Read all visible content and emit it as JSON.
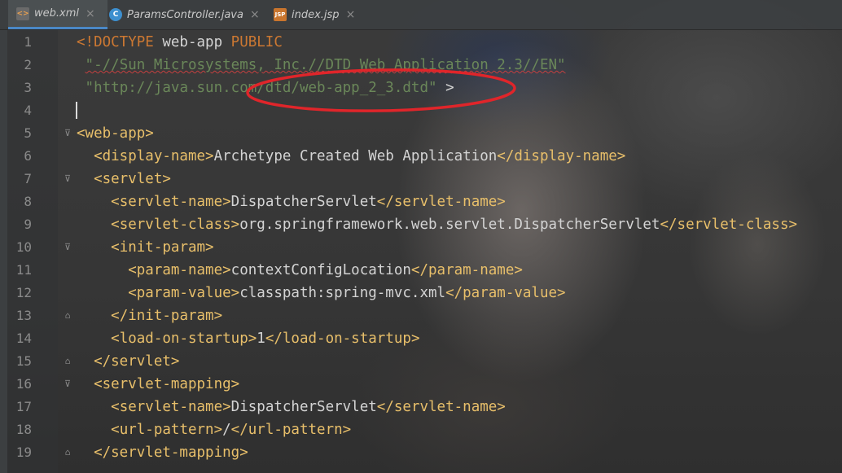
{
  "tabs": [
    {
      "label": "web.xml",
      "icon": "xml-file-icon",
      "active": true
    },
    {
      "label": "ParamsController.java",
      "icon": "java-class-icon",
      "active": false
    },
    {
      "label": "index.jsp",
      "icon": "jsp-file-icon",
      "active": false
    }
  ],
  "lines": [
    {
      "n": "1",
      "html": "<span class=\"kw\">&lt;!DOCTYPE</span><span class=\"txt\"> web-app </span><span class=\"kw\">PUBLIC</span>"
    },
    {
      "n": "2",
      "html": " <span class=\"str squig\">\"-//Sun Microsystems, Inc.//DTD Web Application 2.3//EN\"</span>"
    },
    {
      "n": "3",
      "html": " <span class=\"str\">\"http://java.sun.com/dtd/web-app_2_3.dtd\"</span><span class=\"txt\"> &gt;</span>"
    },
    {
      "n": "4",
      "html": ""
    },
    {
      "n": "5",
      "html": "<span class=\"tag\">&lt;web-app&gt;</span>"
    },
    {
      "n": "6",
      "html": "  <span class=\"tag\">&lt;display-name&gt;</span><span class=\"txt\">Archetype Created Web Application</span><span class=\"tag\">&lt;/display-name&gt;</span>"
    },
    {
      "n": "7",
      "html": "  <span class=\"tag\">&lt;servlet&gt;</span>"
    },
    {
      "n": "8",
      "html": "    <span class=\"tag\">&lt;servlet-name&gt;</span><span class=\"txt\">DispatcherServlet</span><span class=\"tag\">&lt;/servlet-name&gt;</span>"
    },
    {
      "n": "9",
      "html": "    <span class=\"tag\">&lt;servlet-class&gt;</span><span class=\"txt\">org.springframework.web.servlet.DispatcherServlet</span><span class=\"tag\">&lt;/servlet-class&gt;</span>"
    },
    {
      "n": "10",
      "html": "    <span class=\"tag\">&lt;init-param&gt;</span>"
    },
    {
      "n": "11",
      "html": "      <span class=\"tag\">&lt;param-name&gt;</span><span class=\"txt\">contextConfigLocation</span><span class=\"tag\">&lt;/param-name&gt;</span>"
    },
    {
      "n": "12",
      "html": "      <span class=\"tag\">&lt;param-value&gt;</span><span class=\"txt\">classpath:spring-mvc.xml</span><span class=\"tag\">&lt;/param-value&gt;</span>"
    },
    {
      "n": "13",
      "html": "    <span class=\"tag\">&lt;/init-param&gt;</span>"
    },
    {
      "n": "14",
      "html": "    <span class=\"tag\">&lt;load-on-startup&gt;</span><span class=\"txt\">1</span><span class=\"tag\">&lt;/load-on-startup&gt;</span>"
    },
    {
      "n": "15",
      "html": "  <span class=\"tag\">&lt;/servlet&gt;</span>"
    },
    {
      "n": "16",
      "html": "  <span class=\"tag\">&lt;servlet-mapping&gt;</span>"
    },
    {
      "n": "17",
      "html": "    <span class=\"tag\">&lt;servlet-name&gt;</span><span class=\"txt\">DispatcherServlet</span><span class=\"tag\">&lt;/servlet-name&gt;</span>"
    },
    {
      "n": "18",
      "html": "    <span class=\"tag\">&lt;url-pattern&gt;</span><span class=\"txt\">/</span><span class=\"tag\">&lt;/url-pattern&gt;</span>"
    },
    {
      "n": "19",
      "html": "  <span class=\"tag\">&lt;/servlet-mapping&gt;</span>"
    }
  ],
  "folds": {
    "5": "open",
    "7": "open",
    "10": "open",
    "13": "close",
    "15": "close",
    "16": "open",
    "19": "close"
  },
  "annotation": {
    "shape": "red-ellipse",
    "color": "#e0252a",
    "target_text": "dtd/web-app_2_3.dtd"
  }
}
